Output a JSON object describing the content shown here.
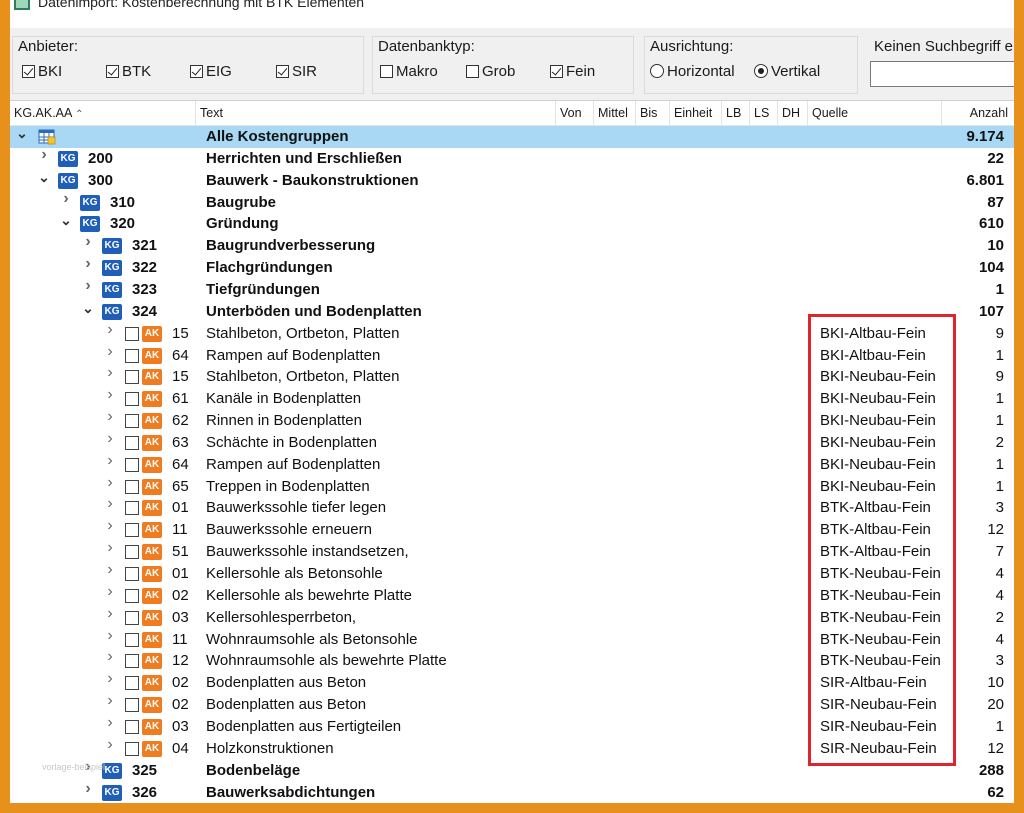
{
  "window": {
    "title": "Datenimport: Kostenberechnung mit BTK Elementen"
  },
  "filters": {
    "anbieter": {
      "label": "Anbieter:",
      "options": [
        {
          "label": "BKI",
          "checked": true
        },
        {
          "label": "BTK",
          "checked": true
        },
        {
          "label": "EIG",
          "checked": true
        },
        {
          "label": "SIR",
          "checked": true
        }
      ]
    },
    "datenbanktyp": {
      "label": "Datenbanktyp:",
      "options": [
        {
          "label": "Makro",
          "checked": false
        },
        {
          "label": "Grob",
          "checked": false
        },
        {
          "label": "Fein",
          "checked": true
        }
      ]
    },
    "ausrichtung": {
      "label": "Ausrichtung:",
      "options": [
        {
          "label": "Horizontal",
          "selected": false
        },
        {
          "label": "Vertikal",
          "selected": true
        }
      ]
    },
    "search": {
      "label": "Keinen Suchbegriff e",
      "value": ""
    }
  },
  "columns": {
    "code": "KG.AK.AA",
    "text": "Text",
    "von": "Von",
    "mittel": "Mittel",
    "bis": "Bis",
    "einheit": "Einheit",
    "lb": "LB",
    "ls": "LS",
    "dh": "DH",
    "quelle": "Quelle",
    "anzahl": "Anzahl"
  },
  "rows": [
    {
      "type": "root",
      "code": "",
      "text": "Alle Kostengruppen",
      "quelle": "",
      "count": "9.174",
      "expanded": true,
      "selected": true
    },
    {
      "type": "kg",
      "level": 1,
      "code": "200",
      "text": "Herrichten und Erschließen",
      "quelle": "",
      "count": "22",
      "expanded": false
    },
    {
      "type": "kg",
      "level": 1,
      "code": "300",
      "text": "Bauwerk - Baukonstruktionen",
      "quelle": "",
      "count": "6.801",
      "expanded": true
    },
    {
      "type": "kg",
      "level": 2,
      "code": "310",
      "text": "Baugrube",
      "quelle": "",
      "count": "87",
      "expanded": false
    },
    {
      "type": "kg",
      "level": 2,
      "code": "320",
      "text": "Gründung",
      "quelle": "",
      "count": "610",
      "expanded": true
    },
    {
      "type": "kg",
      "level": 3,
      "code": "321",
      "text": "Baugrundverbesserung",
      "quelle": "",
      "count": "10",
      "expanded": false
    },
    {
      "type": "kg",
      "level": 3,
      "code": "322",
      "text": "Flachgründungen",
      "quelle": "",
      "count": "104",
      "expanded": false
    },
    {
      "type": "kg",
      "level": 3,
      "code": "323",
      "text": "Tiefgründungen",
      "quelle": "",
      "count": "1",
      "expanded": false
    },
    {
      "type": "kg",
      "level": 3,
      "code": "324",
      "text": "Unterböden und Bodenplatten",
      "quelle": "",
      "count": "107",
      "expanded": true
    },
    {
      "type": "ak",
      "code": "15",
      "text": "Stahlbeton, Ortbeton, Platten",
      "quelle": "BKI-Altbau-Fein",
      "count": "9"
    },
    {
      "type": "ak",
      "code": "64",
      "text": "Rampen auf Bodenplatten",
      "quelle": "BKI-Altbau-Fein",
      "count": "1"
    },
    {
      "type": "ak",
      "code": "15",
      "text": "Stahlbeton, Ortbeton, Platten",
      "quelle": "BKI-Neubau-Fein",
      "count": "9"
    },
    {
      "type": "ak",
      "code": "61",
      "text": "Kanäle in Bodenplatten",
      "quelle": "BKI-Neubau-Fein",
      "count": "1"
    },
    {
      "type": "ak",
      "code": "62",
      "text": "Rinnen in Bodenplatten",
      "quelle": "BKI-Neubau-Fein",
      "count": "1"
    },
    {
      "type": "ak",
      "code": "63",
      "text": "Schächte in Bodenplatten",
      "quelle": "BKI-Neubau-Fein",
      "count": "2"
    },
    {
      "type": "ak",
      "code": "64",
      "text": "Rampen auf Bodenplatten",
      "quelle": "BKI-Neubau-Fein",
      "count": "1"
    },
    {
      "type": "ak",
      "code": "65",
      "text": "Treppen in Bodenplatten",
      "quelle": "BKI-Neubau-Fein",
      "count": "1"
    },
    {
      "type": "ak",
      "code": "01",
      "text": "Bauwerkssohle tiefer legen",
      "quelle": "BTK-Altbau-Fein",
      "count": "3"
    },
    {
      "type": "ak",
      "code": "11",
      "text": "Bauwerkssohle erneuern",
      "quelle": "BTK-Altbau-Fein",
      "count": "12"
    },
    {
      "type": "ak",
      "code": "51",
      "text": "Bauwerkssohle instandsetzen,",
      "quelle": "BTK-Altbau-Fein",
      "count": "7"
    },
    {
      "type": "ak",
      "code": "01",
      "text": "Kellersohle als Betonsohle",
      "quelle": "BTK-Neubau-Fein",
      "count": "4"
    },
    {
      "type": "ak",
      "code": "02",
      "text": "Kellersohle als bewehrte Platte",
      "quelle": "BTK-Neubau-Fein",
      "count": "4"
    },
    {
      "type": "ak",
      "code": "03",
      "text": "Kellersohlesperrbeton,",
      "quelle": "BTK-Neubau-Fein",
      "count": "2"
    },
    {
      "type": "ak",
      "code": "11",
      "text": "Wohnraumsohle als Betonsohle",
      "quelle": "BTK-Neubau-Fein",
      "count": "4"
    },
    {
      "type": "ak",
      "code": "12",
      "text": "Wohnraumsohle als bewehrte Platte",
      "quelle": "BTK-Neubau-Fein",
      "count": "3"
    },
    {
      "type": "ak",
      "code": "02",
      "text": "Bodenplatten aus Beton",
      "quelle": "SIR-Altbau-Fein",
      "count": "10"
    },
    {
      "type": "ak",
      "code": "02",
      "text": "Bodenplatten aus Beton",
      "quelle": "SIR-Neubau-Fein",
      "count": "20"
    },
    {
      "type": "ak",
      "code": "03",
      "text": "Bodenplatten aus Fertigteilen",
      "quelle": "SIR-Neubau-Fein",
      "count": "1"
    },
    {
      "type": "ak",
      "code": "04",
      "text": "Holzkonstruktionen",
      "quelle": "SIR-Neubau-Fein",
      "count": "12"
    },
    {
      "type": "kg",
      "level": 3,
      "code": "325",
      "text": "Bodenbeläge",
      "quelle": "",
      "count": "288",
      "expanded": false
    },
    {
      "type": "kg",
      "level": 3,
      "code": "326",
      "text": "Bauwerksabdichtungen",
      "quelle": "",
      "count": "62",
      "expanded": false
    }
  ],
  "icons": {
    "kg": "KG",
    "ak": "AK",
    "expand": "chevron-right-icon",
    "collapse": "chevron-down-icon",
    "sort": "sort-up-icon"
  },
  "watermark": "vorlage-beispiel",
  "colors": {
    "selection": "#a8d8f4",
    "kg_badge": "#1f5fb8",
    "ak_badge": "#f07c22",
    "highlight": "#e0242e",
    "frame": "#e8901c"
  }
}
